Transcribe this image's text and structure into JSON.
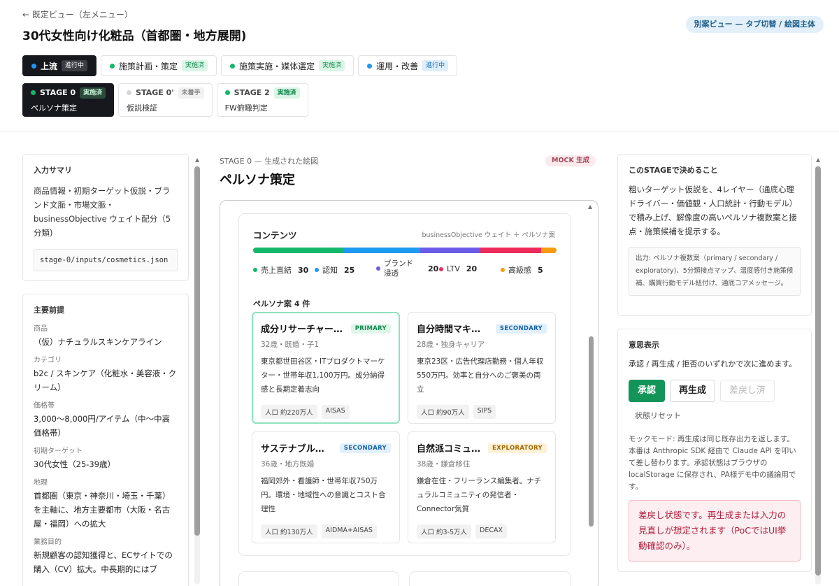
{
  "header": {
    "back_link": "← 既定ビュー（左メニュー）",
    "title": "30代女性向け化粧品（首都圏・地方展開)",
    "alt_view": "別案ビュー — タブ切替 / 絵図主体"
  },
  "phases": [
    {
      "label": "上流",
      "badge": "進行中",
      "dot": "blue",
      "active": true
    },
    {
      "label": "施策計画・策定",
      "badge": "実施済",
      "dot": "green",
      "active": false
    },
    {
      "label": "施策実施・媒体選定",
      "badge": "実施済",
      "dot": "green",
      "active": false
    },
    {
      "label": "運用・改善",
      "badge": "進行中",
      "dot": "blue",
      "active": false
    }
  ],
  "stages": [
    {
      "label": "STAGE 0",
      "badge": "実施済",
      "sub": "ペルソナ策定",
      "active": true
    },
    {
      "label": "STAGE 0'",
      "badge": "未着手",
      "sub": "仮説検証",
      "active": false
    },
    {
      "label": "STAGE 2",
      "badge": "実施済",
      "sub": "FW俯瞰判定",
      "active": false
    }
  ],
  "input_summary": {
    "title": "入力サマリ",
    "text": "商品情報・初期ターゲット仮説・ブランド文脈・市場文脈・businessObjective ウェイト配分（5分類)",
    "file": "stage-0/inputs/cosmetics.json"
  },
  "premises": {
    "title": "主要前提",
    "fields": [
      {
        "label": "商品",
        "value": "（仮）ナチュラルスキンケアライン"
      },
      {
        "label": "カテゴリ",
        "value": "b2c / スキンケア（化粧水・美容液・クリーム）"
      },
      {
        "label": "価格帯",
        "value": "3,000〜8,000円/アイテム（中〜中高価格帯）"
      },
      {
        "label": "初期ターゲット",
        "value": "30代女性（25-39歳）"
      },
      {
        "label": "地理",
        "value": "首都圏（東京・神奈川・埼玉・千葉）を主軸に、地方主要都市（大阪・名古屋・福岡）への拡大"
      },
      {
        "label": "業務目的",
        "value": "新規顧客の認知獲得と、ECサイトでの購入（CV）拡大。中長期的にはブ"
      }
    ]
  },
  "center": {
    "label": "STAGE 0 — 生成された絵図",
    "mock_badge": "MOCK 生成",
    "title": "ペルソナ策定",
    "card_title": "コンテンツ",
    "card_meta": "businessObjective ウェイト ＋ ペルソナ案",
    "weights": [
      {
        "label": "売上直結",
        "value": 30,
        "color": "#14b86a"
      },
      {
        "label": "認知",
        "value": 25,
        "color": "#1e9bef"
      },
      {
        "label": "ブランド浸透",
        "value": 20,
        "color": "#6b5ce7"
      },
      {
        "label": "LTV",
        "value": 20,
        "color": "#ee2c5c"
      },
      {
        "label": "高級感",
        "value": 5,
        "color": "#f79a0e"
      }
    ],
    "persona_count": "ペルソナ案 4 件",
    "personas": [
      {
        "name": "成分リサーチャー…",
        "tag": "PRIMARY",
        "tag_class": "primary",
        "sub": "32歳・既婚・子1",
        "desc": "東京都世田谷区・ITプロダクトマーケター・世帯年収1,100万円。成分納得感と長期定着志向",
        "chips": [
          "人口 約220万人",
          "AISAS"
        ]
      },
      {
        "name": "自分時間マキ…",
        "tag": "SECONDARY",
        "tag_class": "secondary",
        "sub": "28歳・独身キャリア",
        "desc": "東京23区・広告代理店勤務・個人年収550万円。効率と自分へのご褒美の両立",
        "chips": [
          "人口 約90万人",
          "SIPS"
        ]
      },
      {
        "name": "サステナブル…",
        "tag": "SECONDARY",
        "tag_class": "secondary",
        "sub": "36歳・地方既婚",
        "desc": "福岡郊外・看護師・世帯年収750万円。環境・地域性への意識とコスト合理性",
        "chips": [
          "人口 約130万人",
          "AIDMA+AISAS"
        ]
      },
      {
        "name": "自然派コミュ…",
        "tag": "EXPLORATORY",
        "tag_class": "exploratory",
        "sub": "38歳・鎌倉移住",
        "desc": "鎌倉在住・フリーランス編集者。ナチュラルコミュニティの発信者・Connector気質",
        "chips": [
          "人口 約3-5万人",
          "DECAX"
        ]
      }
    ]
  },
  "stage_panel": {
    "title": "このSTAGEで決めること",
    "text": "粗いターゲット仮説を、4レイヤー（通底心理ドライバー・価値観・人口統計・行動モデル）で積み上げ、解像度の高いペルソナ複数案と接点・施策候補を提示する。",
    "output": "出力: ペルソナ複数案（primary / secondary / exploratory)、5分類接点マップ、温度感付き施策候補、購買行動モデル紐付け、通底コアメッセージ。"
  },
  "decision": {
    "title": "意思表示",
    "text": "承認 / 再生成 / 拒否のいずれかで次に進めます。",
    "approve": "承認",
    "regenerate": "再生成",
    "sendback": "差戻し済",
    "reset": "状態リセット",
    "note": "モックモード: 再生成は同じ既存出力を返します。本番は Anthropic SDK 経由で Claude API を叩いて差し替わります。承認状態はブラウザの localStorage に保存され、PA様デモ中の議論用です。",
    "alert": "差戻し状態です。再生成または入力の見直しが想定されます（PoCではUI挙動確認のみ）。"
  }
}
